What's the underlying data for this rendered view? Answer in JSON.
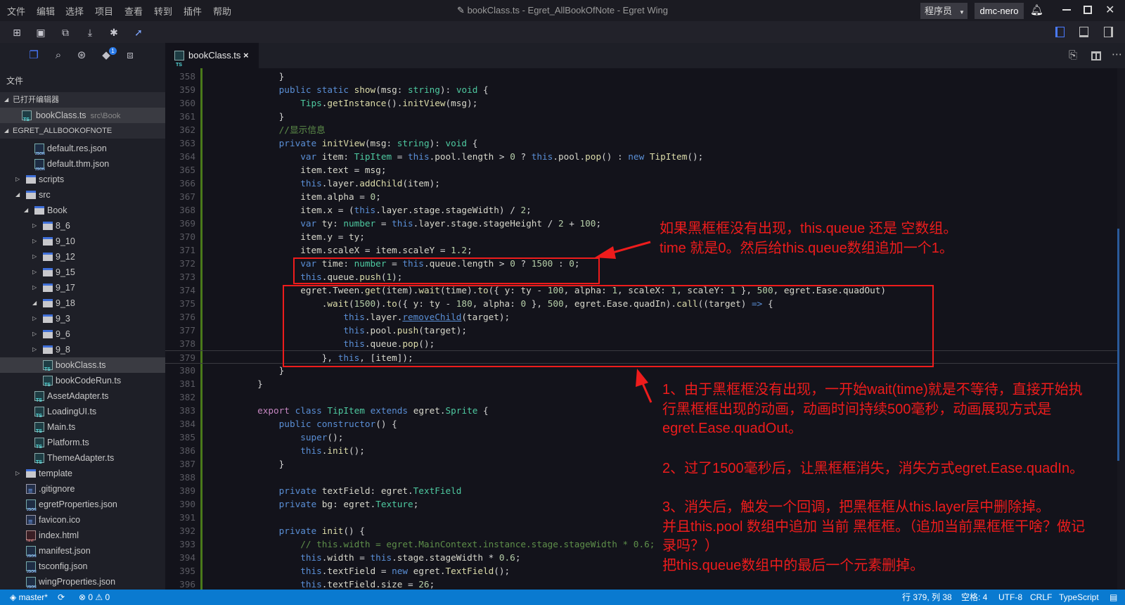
{
  "menu": [
    "文件",
    "编辑",
    "选择",
    "项目",
    "查看",
    "转到",
    "插件",
    "帮助"
  ],
  "window_title": "bookClass.ts - Egret_AllBookOfNote - Egret Wing",
  "role_select": "程序员",
  "user": "dmc-nero",
  "toolbar_icons": [
    "new-project-icon",
    "save-icon",
    "save-all-icon",
    "build-icon",
    "debug-icon",
    "publish-rocket-icon"
  ],
  "layout_icons": [
    "toggle-sidebar-icon",
    "toggle-panel-icon",
    "toggle-right-panel-icon"
  ],
  "activity_icons": [
    "explorer-icon",
    "search-icon",
    "debug-icon",
    "git-icon",
    "extensions-icon"
  ],
  "git_badge": "1",
  "sidebar": {
    "title": "文件",
    "open_editors_header": "已打开编辑器",
    "open_editors": [
      {
        "name": "bookClass.ts",
        "path": "src\\Book"
      }
    ],
    "project_header": "EGRET_ALLBOOKOFNOTE",
    "tree": [
      {
        "name": "default.res.json",
        "type": "json",
        "depth": 3
      },
      {
        "name": "default.thm.json",
        "type": "json",
        "depth": 3
      },
      {
        "name": "scripts",
        "type": "folder",
        "depth": 2,
        "open": false
      },
      {
        "name": "src",
        "type": "folder",
        "depth": 2,
        "open": true
      },
      {
        "name": "Book",
        "type": "folder",
        "depth": 3,
        "open": true
      },
      {
        "name": "8_6",
        "type": "folder",
        "depth": 4,
        "open": false
      },
      {
        "name": "9_10",
        "type": "folder",
        "depth": 4,
        "open": false
      },
      {
        "name": "9_12",
        "type": "folder",
        "depth": 4,
        "open": false
      },
      {
        "name": "9_15",
        "type": "folder",
        "depth": 4,
        "open": false
      },
      {
        "name": "9_17",
        "type": "folder",
        "depth": 4,
        "open": false
      },
      {
        "name": "9_18",
        "type": "folder",
        "depth": 4,
        "open": true
      },
      {
        "name": "9_3",
        "type": "folder",
        "depth": 4,
        "open": false
      },
      {
        "name": "9_6",
        "type": "folder",
        "depth": 4,
        "open": false
      },
      {
        "name": "9_8",
        "type": "folder",
        "depth": 4,
        "open": false
      },
      {
        "name": "bookClass.ts",
        "type": "ts",
        "depth": 4,
        "selected": true
      },
      {
        "name": "bookCodeRun.ts",
        "type": "ts",
        "depth": 4
      },
      {
        "name": "AssetAdapter.ts",
        "type": "ts",
        "depth": 3
      },
      {
        "name": "LoadingUI.ts",
        "type": "ts",
        "depth": 3
      },
      {
        "name": "Main.ts",
        "type": "ts",
        "depth": 3
      },
      {
        "name": "Platform.ts",
        "type": "ts",
        "depth": 3
      },
      {
        "name": "ThemeAdapter.ts",
        "type": "ts",
        "depth": 3
      },
      {
        "name": "template",
        "type": "folder",
        "depth": 2,
        "open": false
      },
      {
        "name": ".gitignore",
        "type": "txt",
        "depth": 2
      },
      {
        "name": "egretProperties.json",
        "type": "json",
        "depth": 2
      },
      {
        "name": "favicon.ico",
        "type": "txt",
        "depth": 2
      },
      {
        "name": "index.html",
        "type": "html",
        "depth": 2
      },
      {
        "name": "manifest.json",
        "type": "json",
        "depth": 2
      },
      {
        "name": "tsconfig.json",
        "type": "json",
        "depth": 2
      },
      {
        "name": "wingProperties.json",
        "type": "json",
        "depth": 2
      }
    ]
  },
  "tab": {
    "label": "bookClass.ts",
    "close": "×"
  },
  "editor_actions": [
    "open-preview-icon",
    "split-editor-icon",
    "more-icon"
  ],
  "code": [
    {
      "n": "358",
      "t": "            }"
    },
    {
      "n": "359",
      "t": "            public static show(msg: string): void {"
    },
    {
      "n": "360",
      "t": "                Tips.getInstance().initView(msg);"
    },
    {
      "n": "361",
      "t": "            }"
    },
    {
      "n": "362",
      "t": "            //显示信息"
    },
    {
      "n": "363",
      "t": "            private initView(msg: string): void {"
    },
    {
      "n": "364",
      "t": "                var item: TipItem = this.pool.length > 0 ? this.pool.pop() : new TipItem();"
    },
    {
      "n": "365",
      "t": "                item.text = msg;"
    },
    {
      "n": "366",
      "t": "                this.layer.addChild(item);"
    },
    {
      "n": "367",
      "t": "                item.alpha = 0;"
    },
    {
      "n": "368",
      "t": "                item.x = (this.layer.stage.stageWidth) / 2;"
    },
    {
      "n": "369",
      "t": "                var ty: number = this.layer.stage.stageHeight / 2 + 100;"
    },
    {
      "n": "370",
      "t": "                item.y = ty;"
    },
    {
      "n": "371",
      "t": "                item.scaleX = item.scaleY = 1.2;"
    },
    {
      "n": "372",
      "t": "                var time: number = this.queue.length > 0 ? 1500 : 0;"
    },
    {
      "n": "373",
      "t": "                this.queue.push(1);"
    },
    {
      "n": "374",
      "t": "                egret.Tween.get(item).wait(time).to({ y: ty - 100, alpha: 1, scaleX: 1, scaleY: 1 }, 500, egret.Ease.quadOut)"
    },
    {
      "n": "375",
      "t": "                    .wait(1500).to({ y: ty - 180, alpha: 0 }, 500, egret.Ease.quadIn).call((target) => {"
    },
    {
      "n": "376",
      "t": "                        this.layer.removeChild(target);"
    },
    {
      "n": "377",
      "t": "                        this.pool.push(target);"
    },
    {
      "n": "378",
      "t": "                        this.queue.pop();"
    },
    {
      "n": "379",
      "t": "                    }, this, [item]);",
      "current": true
    },
    {
      "n": "380",
      "t": "            }"
    },
    {
      "n": "381",
      "t": "        }"
    },
    {
      "n": "382",
      "t": ""
    },
    {
      "n": "383",
      "t": "        export class TipItem extends egret.Sprite {"
    },
    {
      "n": "384",
      "t": "            public constructor() {"
    },
    {
      "n": "385",
      "t": "                super();"
    },
    {
      "n": "386",
      "t": "                this.init();"
    },
    {
      "n": "387",
      "t": "            }"
    },
    {
      "n": "388",
      "t": ""
    },
    {
      "n": "389",
      "t": "            private textField: egret.TextField"
    },
    {
      "n": "390",
      "t": "            private bg: egret.Texture;"
    },
    {
      "n": "391",
      "t": ""
    },
    {
      "n": "392",
      "t": "            private init() {"
    },
    {
      "n": "393",
      "t": "                // this.width = egret.MainContext.instance.stage.stageWidth * 0.6;"
    },
    {
      "n": "394",
      "t": "                this.width = this.stage.stageWidth * 0.6;"
    },
    {
      "n": "395",
      "t": "                this.textField = new egret.TextField();"
    },
    {
      "n": "396",
      "t": "                this.textField.size = 26;"
    }
  ],
  "annotations": {
    "note1": [
      "如果黑框框没有出现，this.queue 还是 空数组。",
      "time 就是0。然后给this.queue数组追加一个1。"
    ],
    "note2": [
      "1、由于黑框框没有出现，一开始wait(time)就是不等待，直接开始执",
      "行黑框框出现的动画，动画时间持续500毫秒，动画展现方式是",
      "egret.Ease.quadOut。"
    ],
    "note3": [
      "2、过了1500毫秒后，让黑框框消失，消失方式egret.Ease.quadIn。"
    ],
    "note4": [
      "3、消失后，触发一个回调，把黑框框从this.layer层中删除掉。",
      "并且this.pool 数组中追加 当前 黑框框。（追加当前黑框框干啥？做记",
      "录吗？）",
      "把this.queue数组中的最后一个元素删掉。"
    ],
    "color": "#ee1c1c"
  },
  "status": {
    "branch": "master*",
    "errors": "0",
    "warnings": "0",
    "position": "行 379, 列 38",
    "indent": "空格: 4",
    "encoding": "UTF-8",
    "eol": "CRLF",
    "language": "TypeScript",
    "color": "#0a7ad0"
  }
}
